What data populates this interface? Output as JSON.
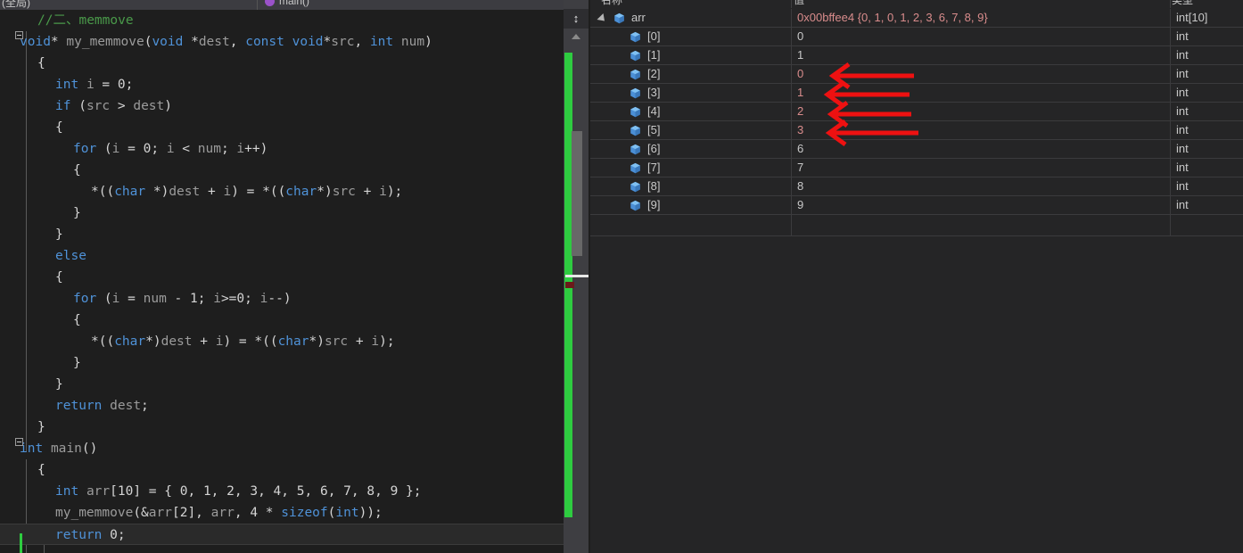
{
  "editor": {
    "nav": {
      "scope": "(全局)",
      "function": "main()",
      "function_icon": "method-purple-icon"
    },
    "code_lines": [
      {
        "indent": 1,
        "fold": false,
        "text": "//二、memmove",
        "cls": "cm"
      },
      {
        "indent": 0,
        "fold": true,
        "text": "void* my_memmove(void *dest, const void*src, int num)"
      },
      {
        "indent": 1,
        "fold": false,
        "text": "{"
      },
      {
        "indent": 2,
        "fold": false,
        "text": "int i = 0;"
      },
      {
        "indent": 2,
        "fold": false,
        "text": "if (src > dest)"
      },
      {
        "indent": 2,
        "fold": false,
        "text": "{"
      },
      {
        "indent": 3,
        "fold": false,
        "text": "for (i = 0; i < num; i++)"
      },
      {
        "indent": 3,
        "fold": false,
        "text": "{"
      },
      {
        "indent": 4,
        "fold": false,
        "text": "*((char *)dest + i) = *((char*)src + i);"
      },
      {
        "indent": 3,
        "fold": false,
        "text": "}"
      },
      {
        "indent": 2,
        "fold": false,
        "text": "}"
      },
      {
        "indent": 2,
        "fold": false,
        "text": "else"
      },
      {
        "indent": 2,
        "fold": false,
        "text": "{"
      },
      {
        "indent": 3,
        "fold": false,
        "text": "for (i = num - 1; i>=0; i--)"
      },
      {
        "indent": 3,
        "fold": false,
        "text": "{"
      },
      {
        "indent": 4,
        "fold": false,
        "text": "*((char*)dest + i) = *((char*)src + i);"
      },
      {
        "indent": 3,
        "fold": false,
        "text": "}"
      },
      {
        "indent": 2,
        "fold": false,
        "text": "}"
      },
      {
        "indent": 2,
        "fold": false,
        "text": "return dest;"
      },
      {
        "indent": 1,
        "fold": false,
        "text": "}"
      },
      {
        "indent": 0,
        "fold": true,
        "text": "int main()"
      },
      {
        "indent": 1,
        "fold": false,
        "text": "{"
      },
      {
        "indent": 2,
        "fold": false,
        "text": "int arr[10] = { 0, 1, 2, 3, 4, 5, 6, 7, 8, 9 };"
      },
      {
        "indent": 2,
        "fold": false,
        "text": "my_memmove(&arr[2], arr, 4 * sizeof(int));"
      },
      {
        "indent": 2,
        "fold": false,
        "text": "return 0;",
        "current": true
      }
    ],
    "scrollbar": {
      "split_icon": "split-view-icon",
      "up_arrow_icon": "scroll-up-arrow-icon"
    }
  },
  "watch": {
    "columns": [
      "名称",
      "值",
      "类型"
    ],
    "rows": [
      {
        "name": "arr",
        "value": "0x00bffee4 {0, 1, 0, 1, 2, 3, 6, 7, 8, 9}",
        "type": "int[10]",
        "level": 0,
        "expanded": true,
        "changed": true,
        "arrow": false
      },
      {
        "name": "[0]",
        "value": "0",
        "type": "int",
        "level": 1,
        "expanded": false,
        "changed": false,
        "arrow": false
      },
      {
        "name": "[1]",
        "value": "1",
        "type": "int",
        "level": 1,
        "expanded": false,
        "changed": false,
        "arrow": false
      },
      {
        "name": "[2]",
        "value": "0",
        "type": "int",
        "level": 1,
        "expanded": false,
        "changed": true,
        "arrow": true
      },
      {
        "name": "[3]",
        "value": "1",
        "type": "int",
        "level": 1,
        "expanded": false,
        "changed": true,
        "arrow": true
      },
      {
        "name": "[4]",
        "value": "2",
        "type": "int",
        "level": 1,
        "expanded": false,
        "changed": true,
        "arrow": true
      },
      {
        "name": "[5]",
        "value": "3",
        "type": "int",
        "level": 1,
        "expanded": false,
        "changed": true,
        "arrow": true
      },
      {
        "name": "[6]",
        "value": "6",
        "type": "int",
        "level": 1,
        "expanded": false,
        "changed": false,
        "arrow": false
      },
      {
        "name": "[7]",
        "value": "7",
        "type": "int",
        "level": 1,
        "expanded": false,
        "changed": false,
        "arrow": false
      },
      {
        "name": "[8]",
        "value": "8",
        "type": "int",
        "level": 1,
        "expanded": false,
        "changed": false,
        "arrow": false
      },
      {
        "name": "[9]",
        "value": "9",
        "type": "int",
        "level": 1,
        "expanded": false,
        "changed": false,
        "arrow": false
      }
    ],
    "annotation_arrow_color": "#ee1111",
    "annotation_arrow_count": 4
  },
  "colors": {
    "editor_bg": "#1e1e1e",
    "panel_bg": "#252526",
    "keyword": "#4f92d8",
    "comment": "#4a9a4a",
    "identifier": "#9b9b9b",
    "change_bar_green": "#2ecc40",
    "changed_value": "#d98c8c",
    "arrow_red": "#ee1111"
  }
}
